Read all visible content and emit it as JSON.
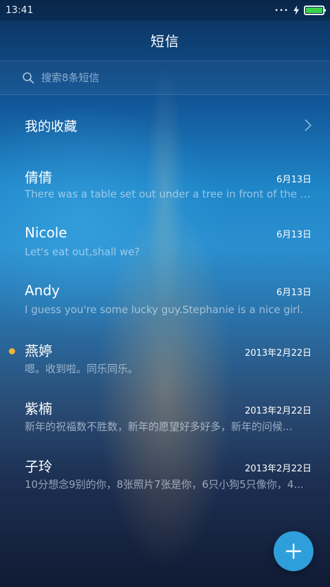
{
  "status_bar": {
    "time": "13:41",
    "battery_level": 1.0,
    "battery_color": "#3ad14a",
    "signal_dots": "•••"
  },
  "header": {
    "title": "短信"
  },
  "search": {
    "placeholder": "搜索8条短信"
  },
  "favorites": {
    "label": "我的收藏"
  },
  "messages": [
    {
      "name": "倩倩",
      "date": "6月13日",
      "preview": "There was a table set out under a tree in front of the ho...",
      "unread": false
    },
    {
      "name": "Nicole",
      "date": "6月13日",
      "preview": "Let's eat out,shall we?",
      "unread": false
    },
    {
      "name": "Andy",
      "date": "6月13日",
      "preview": "I guess you're some lucky guy.Stephanie is a nice girl.",
      "unread": false
    },
    {
      "name": "燕婷",
      "date": "2013年2月22日",
      "preview": "嗯。收到啦。同乐同乐。",
      "unread": true
    },
    {
      "name": "紫楠",
      "date": "2013年2月22日",
      "preview": "新年的祝福数不胜数，新年的愿望好多好多，新年的问候...",
      "unread": false
    },
    {
      "name": "子玲",
      "date": "2013年2月22日",
      "preview": "10分想念9别的你，8张照片7张是你，6只小狗5只像你，4...",
      "unread": false
    }
  ],
  "colors": {
    "accent": "#2f9fdc",
    "unread_dot": "#f2b431"
  },
  "icons": {
    "search": "search-icon",
    "chevron": "chevron-right-icon",
    "compose": "plus-icon",
    "charging": "bolt-icon"
  }
}
